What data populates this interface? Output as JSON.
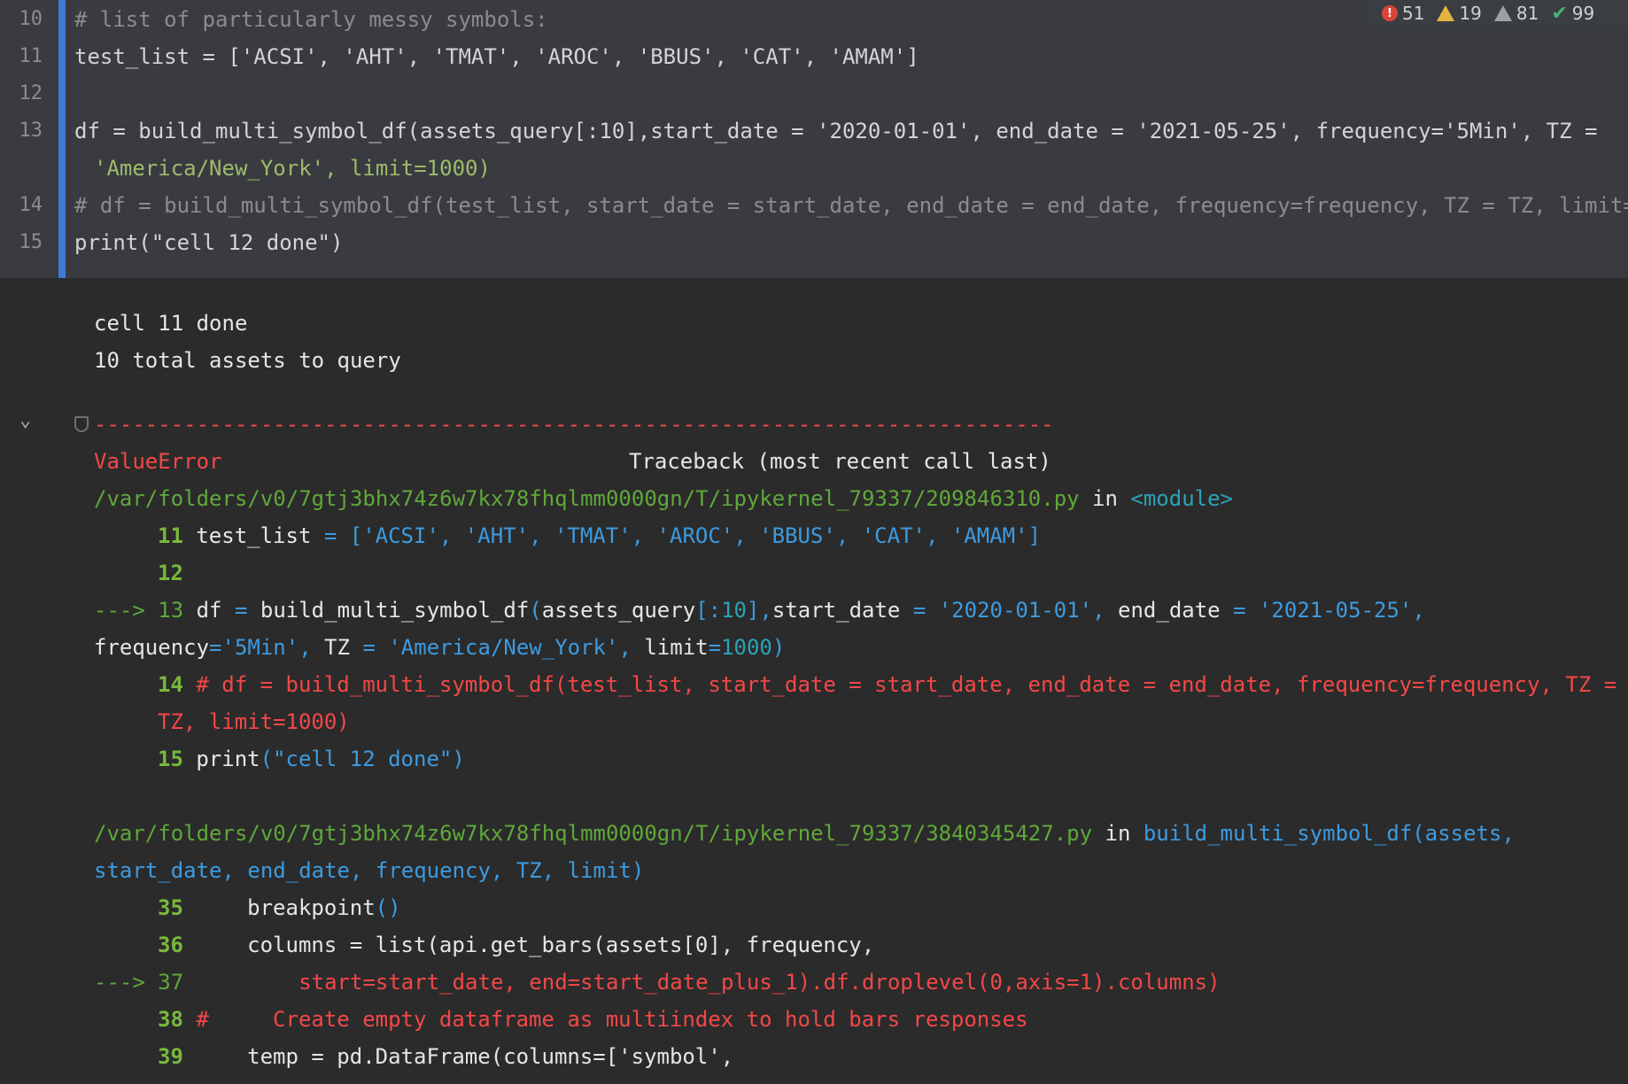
{
  "inspection": {
    "errors": "51",
    "warnings": "19",
    "weak_warnings": "81",
    "ok": "99"
  },
  "cell": {
    "lines": [
      {
        "num": "10",
        "text": "# list of particularly messy symbols:"
      },
      {
        "num": "11",
        "text": "test_list = ['ACSI', 'AHT', 'TMAT', 'AROC', 'BBUS', 'CAT', 'AMAM']"
      },
      {
        "num": "12",
        "text": ""
      },
      {
        "num": "13",
        "text": "df = build_multi_symbol_df(assets_query[:10],start_date = '2020-01-01', end_date = '2021-05-25', frequency='5Min', TZ ="
      },
      {
        "num": "",
        "text": "'America/New_York', limit=1000)"
      },
      {
        "num": "14",
        "text": "# df = build_multi_symbol_df(test_list, start_date = start_date, end_date = end_date, frequency=frequency, TZ = TZ, limit="
      },
      {
        "num": "15",
        "text": "print(\"cell 12 done\")"
      }
    ]
  },
  "output": {
    "stdout": [
      "cell 11 done",
      "10 total assets to query"
    ],
    "traceback": {
      "separator": "---------------------------------------------------------------------------",
      "error_name": "ValueError",
      "header": "Traceback (most recent call last)",
      "frame1_path": "/var/folders/v0/7gtj3bhx74z6w7kx78fhqlmm0000gn/T/ipykernel_79337/209846310.py",
      "frame1_in": "in",
      "frame1_loc": "<module>",
      "frame2_path": "/var/folders/v0/7gtj3bhx74z6w7kx78fhqlmm0000gn/T/ipykernel_79337/3840345427.py",
      "frame2_in": "in",
      "frame2_loc1": "build_multi_symbol_df(assets,",
      "frame2_loc2": "start_date, end_date, frequency, TZ, limit)"
    }
  }
}
